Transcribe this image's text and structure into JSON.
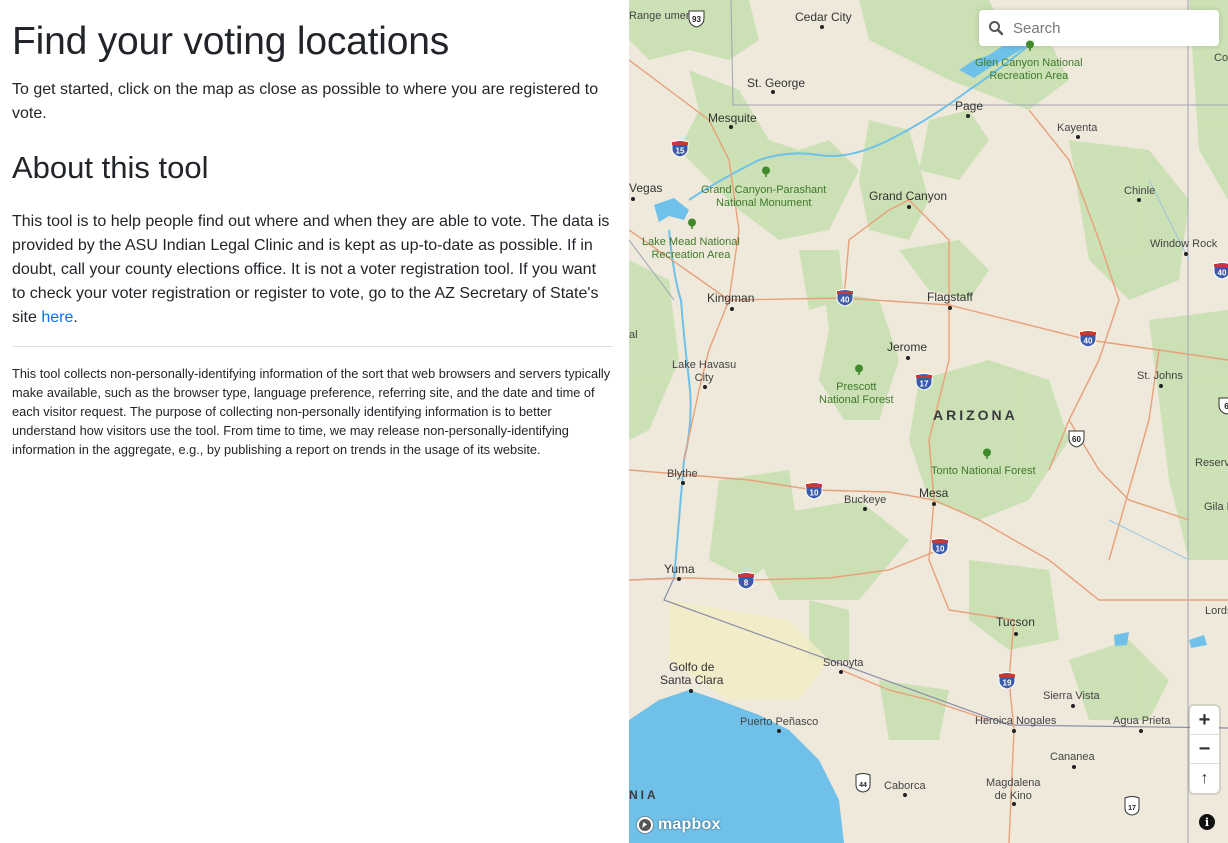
{
  "info": {
    "title": "Find your voting locations",
    "intro": "To get started, click on the map as close as possible to where you are registered to vote.",
    "about_heading": "About this tool",
    "about_text": "This tool is to help people find out where and when they are able to vote. The data is provided by the ASU Indian Legal Clinic and is kept as up-to-date as possible. If in doubt, call your county elections office. It is not a voter registration tool. If you want to check your voter registration or register to vote, go to the AZ Secretary of State's site ",
    "about_link_text": "here",
    "about_end": ".",
    "privacy_text": "This tool collects non-personally-identifying information of the sort that web browsers and servers typically make available, such as the browser type, language preference, referring site, and the date and time of each visitor request. The purpose of collecting non-personally identifying information is to better understand how visitors use the tool. From time to time, we may release non-personally-identifying information in the aggregate, e.g., by publishing a report on trends in the usage of its website."
  },
  "map": {
    "search": {
      "placeholder": "Search"
    },
    "zoom_in": "+",
    "zoom_out": "−",
    "reset_north": "↑",
    "attribution": "i",
    "logo_text": "mapbox",
    "state_label": "ARIZONA",
    "border_label": "NIA",
    "colors": {
      "land": "#efe9dc",
      "park": "#c8e0b0",
      "water": "#6fc1ea",
      "road": "#e8a07a",
      "interstate": "#3b5aa8"
    },
    "places": {
      "cedar_city": "Cedar City",
      "st_george": "St. George",
      "page": "Page",
      "mesquite": "Mesquite",
      "kayenta": "Kayenta",
      "las_vegas": "Vegas",
      "grand_canyon": "Grand Canyon",
      "chinle": "Chinle",
      "window_rock": "Window Rock",
      "kingman": "Kingman",
      "flagstaff": "Flagstaff",
      "jerome": "Jerome",
      "lake_havasu": "Lake Havasu\nCity",
      "st_johns": "St. Johns",
      "blythe": "Blythe",
      "buckeye": "Buckeye",
      "mesa": "Mesa",
      "reserve": "Reserv",
      "gila": "Gila Na",
      "yuma": "Yuma",
      "tucson": "Tucson",
      "lordsburg": "Lordsb",
      "golfo": "Golfo de\nSanta Clara",
      "sonoyta": "Sonoyta",
      "sierra_vista": "Sierra Vista",
      "heroica": "Heroica Nogales",
      "agua_prieta": "Agua Prieta",
      "puerto": "Puerto Peñasco",
      "cananea": "Cananea",
      "caborca": "Caborca",
      "magdalena": "Magdalena\nde Kino",
      "al": "al",
      "cortez": "Co",
      "change": "Range\nument"
    },
    "parks": {
      "glen_canyon": "Glen Canyon National\nRecreation Area",
      "parashant": "Grand Canyon-Parashant\nNational Monument",
      "lake_mead": "Lake Mead National\nRecreation Area",
      "prescott": "Prescott\nNational Forest",
      "tonto": "Tonto National Forest"
    },
    "shields": {
      "i15": "15",
      "i40a": "40",
      "i40b": "40",
      "i40c": "40",
      "i17": "17",
      "i10a": "10",
      "i10b": "10",
      "i8": "8",
      "i19": "19",
      "us93": "93",
      "us60": "60",
      "us6": "6",
      "mx44": "44",
      "mx17": "17"
    }
  }
}
